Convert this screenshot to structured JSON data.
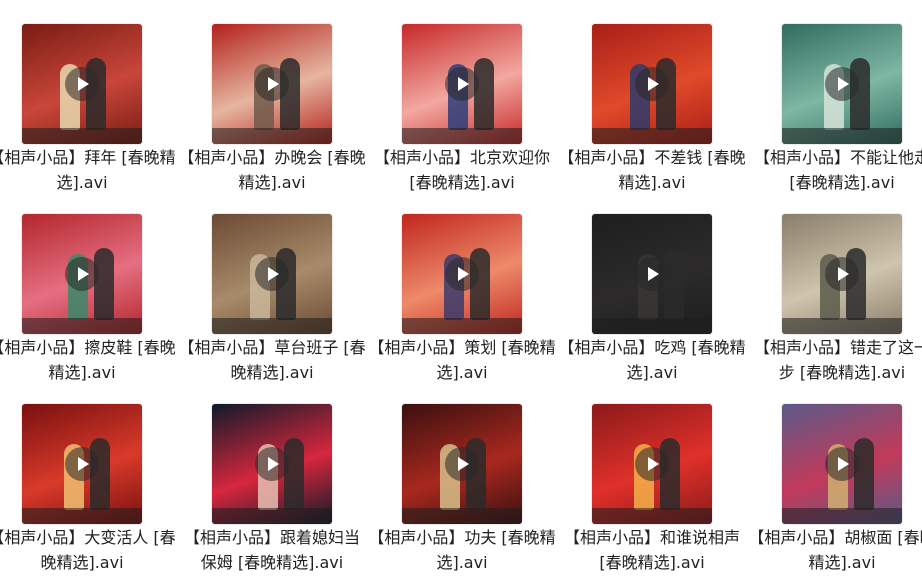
{
  "files": [
    {
      "name": "【相声小品】拜年 [春晚精选].avi",
      "scene": [
        "#7a1c14",
        "#c9463a",
        "#e9d9b0"
      ]
    },
    {
      "name": "【相声小品】办晚会 [春晚精选].avi",
      "scene": [
        "#b3211c",
        "#e6b6a0",
        "#6e5a4a"
      ]
    },
    {
      "name": "【相声小品】北京欢迎你 [春晚精选].avi",
      "scene": [
        "#c62828",
        "#f2a8a0",
        "#2c3e7a"
      ]
    },
    {
      "name": "【相声小品】不差钱 [春晚精选].avi",
      "scene": [
        "#a81e18",
        "#e04a2a",
        "#2d3a6b"
      ]
    },
    {
      "name": "【相声小品】不能让他走 [春晚精选].avi",
      "scene": [
        "#2f6d5e",
        "#7fb6a4",
        "#d6e4da"
      ]
    },
    {
      "name": "【相声小品】擦皮鞋 [春晚精选].avi",
      "scene": [
        "#b3262b",
        "#e56f82",
        "#3a8a6a"
      ]
    },
    {
      "name": "【相声小品】草台班子 [春晚精选].avi",
      "scene": [
        "#6b4a34",
        "#a88b6a",
        "#c9b79a"
      ]
    },
    {
      "name": "【相声小品】策划 [春晚精选].avi",
      "scene": [
        "#c0261e",
        "#ee8a6a",
        "#3b3b6b"
      ]
    },
    {
      "name": "【相声小品】吃鸡 [春晚精选].avi",
      "scene": [
        "#1e1e1e",
        "#2c2a2a",
        "#3a3636"
      ]
    },
    {
      "name": "【相声小品】错走了这一步 [春晚精选].avi",
      "scene": [
        "#8a7d6a",
        "#cfc4ad",
        "#5a5a4a"
      ]
    },
    {
      "name": "【相声小品】大变活人 [春晚精选].avi",
      "scene": [
        "#7a1010",
        "#d83a2a",
        "#f0c070"
      ]
    },
    {
      "name": "【相声小品】跟着媳妇当保姆 [春晚精选].avi",
      "scene": [
        "#0f1a2a",
        "#d7263d",
        "#e8c0b0"
      ]
    },
    {
      "name": "【相声小品】功夫 [春晚精选].avi",
      "scene": [
        "#3a1010",
        "#a8281e",
        "#d6c08a"
      ]
    },
    {
      "name": "【相声小品】和谁说相声 [春晚精选].avi",
      "scene": [
        "#8a1a1a",
        "#e0302a",
        "#f4b04a"
      ]
    },
    {
      "name": "【相声小品】胡椒面 [春晚精选].avi",
      "scene": [
        "#5a5a8a",
        "#c23a5a",
        "#d0b070"
      ]
    }
  ]
}
